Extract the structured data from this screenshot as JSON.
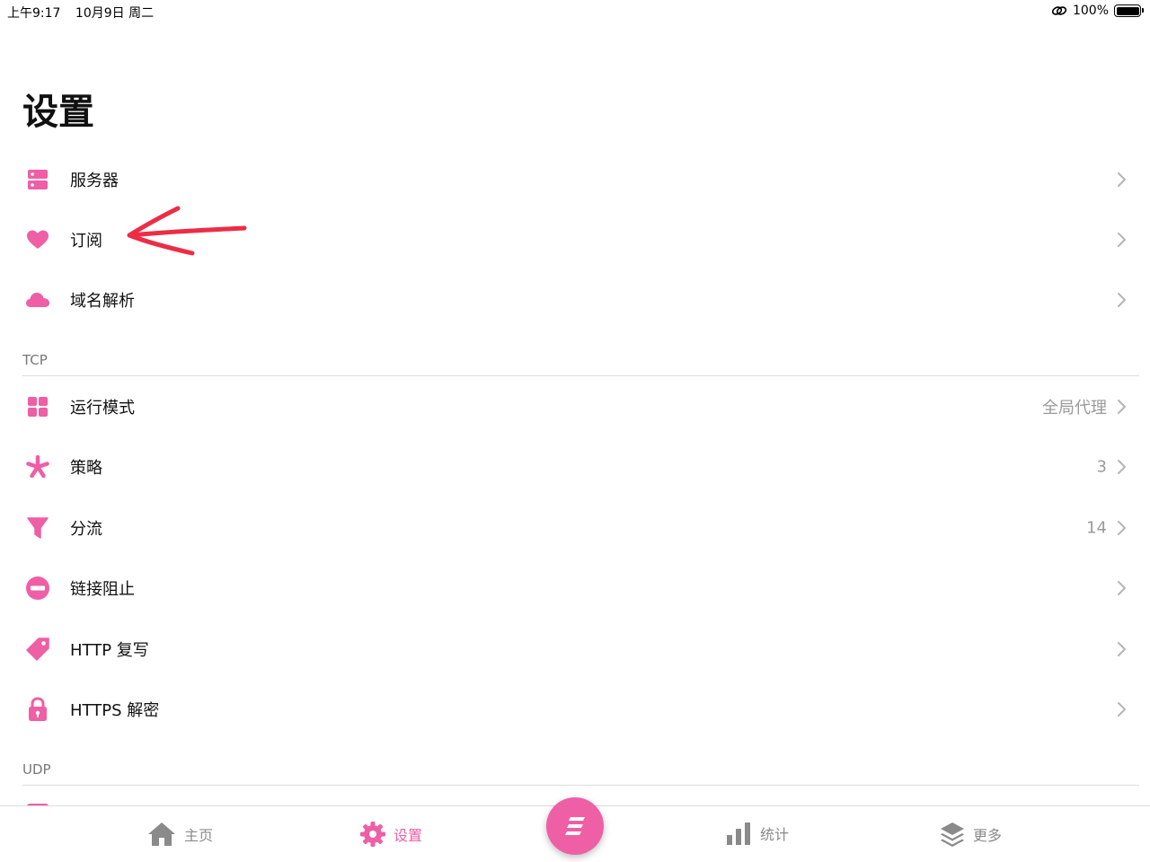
{
  "status": {
    "time": "上午9:17",
    "date": "10月9日 周二",
    "battery": "100%"
  },
  "title": "设置",
  "accent": "#ee5fa6",
  "group1": [
    {
      "icon": "server-icon",
      "label": "服务器",
      "value": ""
    },
    {
      "icon": "heart-icon",
      "label": "订阅",
      "value": ""
    },
    {
      "icon": "cloud-icon",
      "label": "域名解析",
      "value": ""
    }
  ],
  "tcp": {
    "header": "TCP",
    "items": [
      {
        "icon": "grid-icon",
        "label": "运行模式",
        "value": "全局代理"
      },
      {
        "icon": "asterisk-icon",
        "label": "策略",
        "value": "3"
      },
      {
        "icon": "filter-icon",
        "label": "分流",
        "value": "14"
      },
      {
        "icon": "block-icon",
        "label": "链接阻止",
        "value": ""
      },
      {
        "icon": "tag-icon",
        "label": "HTTP 复写",
        "value": ""
      },
      {
        "icon": "lock-icon",
        "label": "HTTPS 解密",
        "value": ""
      }
    ]
  },
  "udp": {
    "header": "UDP"
  },
  "tabs": [
    {
      "icon": "home-icon",
      "label": "主页"
    },
    {
      "icon": "gear-icon",
      "label": "设置"
    },
    {
      "icon": "chart-icon",
      "label": "统计"
    },
    {
      "icon": "layers-icon",
      "label": "更多"
    }
  ]
}
